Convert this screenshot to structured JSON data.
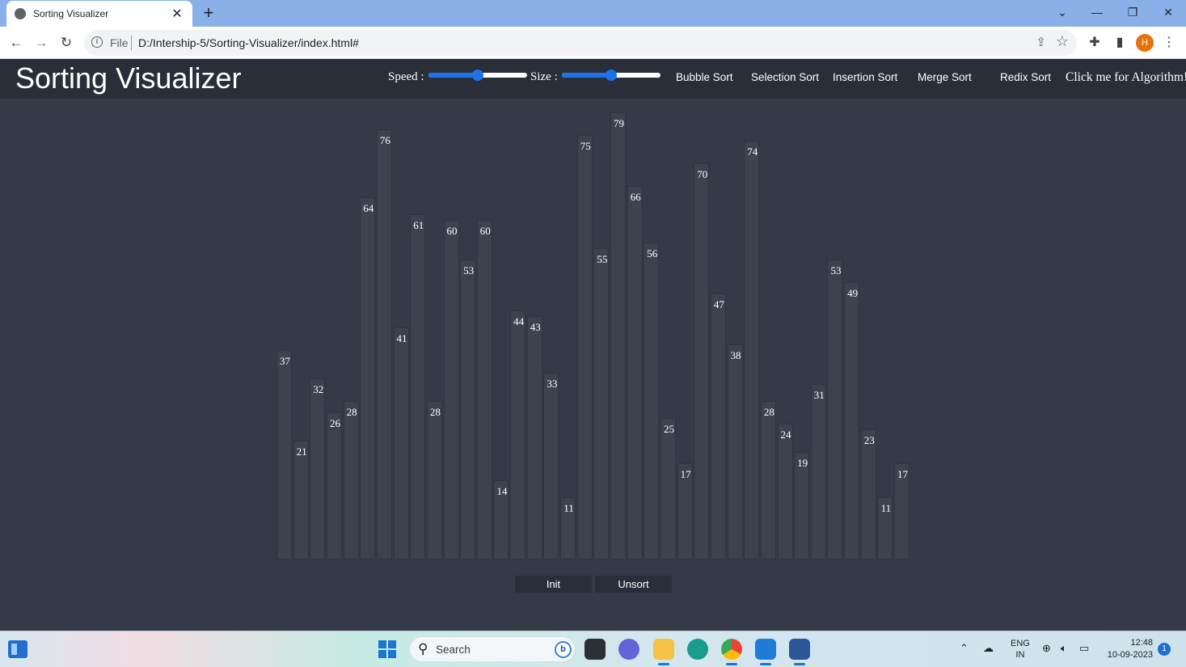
{
  "browser": {
    "tab_title": "Sorting Visualizer",
    "tab_close": "✕",
    "new_tab": "+",
    "url_scheme": "File",
    "url": "D:/Intership-5/Sorting-Visualizer/index.html#",
    "profile_initial": "H"
  },
  "app": {
    "title": "Sorting Visualizer",
    "speed_label": "Speed :",
    "speed_value": 0.5,
    "size_label": "Size :",
    "size_value": 0.5,
    "algorithms": [
      "Bubble Sort",
      "Selection Sort",
      "Insertion Sort",
      "Merge Sort",
      "Redix Sort"
    ],
    "algo_link": "Click me for Algorithm!"
  },
  "bars": [
    37,
    21,
    32,
    26,
    28,
    64,
    76,
    41,
    61,
    28,
    60,
    53,
    60,
    14,
    44,
    43,
    33,
    11,
    75,
    55,
    79,
    66,
    56,
    25,
    17,
    70,
    47,
    38,
    74,
    28,
    24,
    19,
    31,
    53,
    49,
    23,
    11,
    17
  ],
  "buttons": {
    "init": "Init",
    "unsort": "Unsort"
  },
  "taskbar": {
    "search_placeholder": "Search",
    "language": "ENG",
    "region": "IN",
    "time": "12:48",
    "date": "10-09-2023",
    "notifications": "1"
  },
  "colors": {
    "page_bg": "#353a48",
    "header_bg": "#2a2e38",
    "bar_fill": "#3d424f",
    "slider_accent": "#1a73e8"
  }
}
